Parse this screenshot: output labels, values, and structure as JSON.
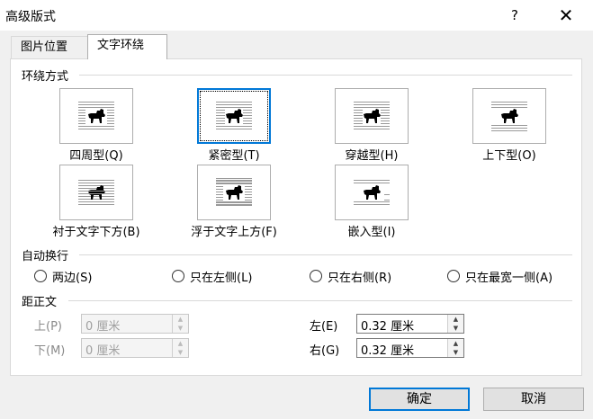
{
  "dialog": {
    "title": "高级版式",
    "help": "?",
    "close": "✕"
  },
  "tabs": [
    "图片位置",
    "文字环绕"
  ],
  "wrap_section": {
    "title": "环绕方式",
    "options": [
      {
        "label": "四周型(Q)",
        "selected": false,
        "style": "square"
      },
      {
        "label": "紧密型(T)",
        "selected": true,
        "style": "tight"
      },
      {
        "label": "穿越型(H)",
        "selected": false,
        "style": "through"
      },
      {
        "label": "上下型(O)",
        "selected": false,
        "style": "topbottom"
      },
      {
        "label": "衬于文字下方(B)",
        "selected": false,
        "style": "behind"
      },
      {
        "label": "浮于文字上方(F)",
        "selected": false,
        "style": "front"
      },
      {
        "label": "嵌入型(I)",
        "selected": false,
        "style": "inline"
      }
    ]
  },
  "auto_wrap": {
    "title": "自动换行",
    "options": [
      "两边(S)",
      "只在左侧(L)",
      "只在右侧(R)",
      "只在最宽一侧(A)"
    ]
  },
  "distance": {
    "title": "距正文",
    "top": {
      "label": "上(P)",
      "value": "0 厘米",
      "enabled": false
    },
    "bottom": {
      "label": "下(M)",
      "value": "0 厘米",
      "enabled": false
    },
    "left": {
      "label": "左(E)",
      "value": "0.32 厘米",
      "enabled": true
    },
    "right": {
      "label": "右(G)",
      "value": "0.32 厘米",
      "enabled": true
    }
  },
  "buttons": {
    "ok": "确定",
    "cancel": "取消"
  },
  "colors": {
    "accent": "#0078d7",
    "disabled_text": "#8a8a8a"
  }
}
